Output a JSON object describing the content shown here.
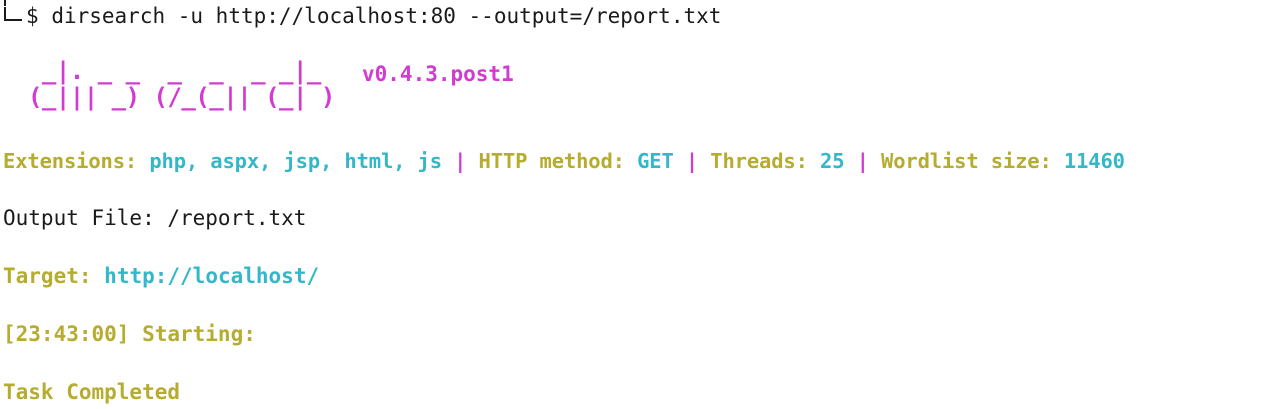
{
  "command": {
    "prompt_symbol": "$",
    "text": "dirsearch -u http://localhost:80 --output=/report.txt"
  },
  "banner": {
    "ascii_art": "  _|. _ _  _  _  _ _|_\n (_||| _) (/_(_|| (_| )",
    "version": "v0.4.3.post1"
  },
  "config": {
    "extensions_label": "Extensions:",
    "extensions_value": "php, aspx, jsp, html, js",
    "separator": "|",
    "method_label": "HTTP method:",
    "method_value": "GET",
    "threads_label": "Threads:",
    "threads_value": "25",
    "wordlist_label": "Wordlist size:",
    "wordlist_value": "11460"
  },
  "output_file": "Output File: /report.txt",
  "target": {
    "label": "Target:",
    "value": "http://localhost/"
  },
  "starting": "[23:43:00] Starting:",
  "completed": "Task Completed",
  "colors": {
    "label": "#b5ac30",
    "value": "#34b8c9",
    "banner": "#d23ad2",
    "text": "#1a1a1a"
  }
}
